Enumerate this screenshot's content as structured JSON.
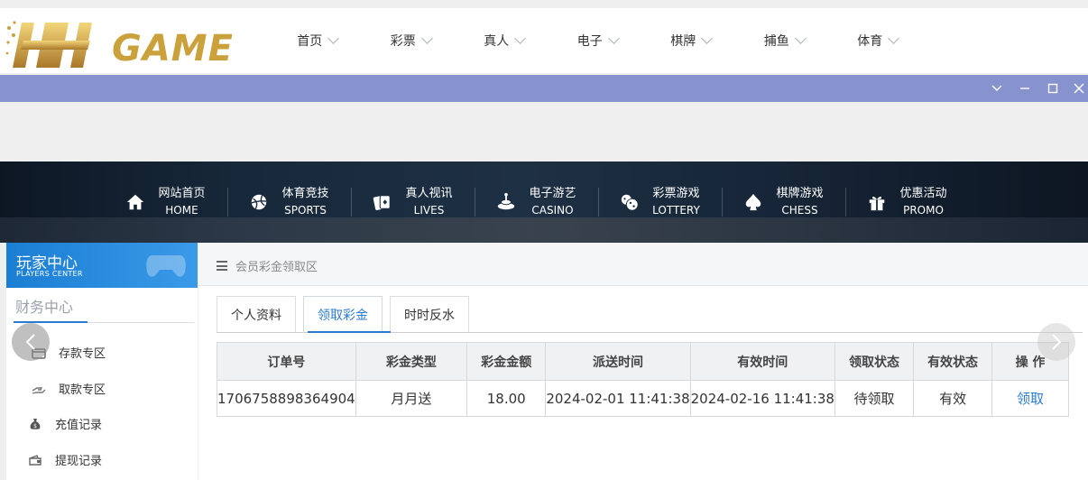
{
  "brand": {
    "logo_text": "GAME"
  },
  "top_menu": [
    {
      "label": "首页"
    },
    {
      "label": "彩票"
    },
    {
      "label": "真人"
    },
    {
      "label": "电子"
    },
    {
      "label": "棋牌"
    },
    {
      "label": "捕鱼"
    },
    {
      "label": "体育"
    }
  ],
  "banner_nav": [
    {
      "cn": "网站首页",
      "en": "HOME",
      "icon": "home-icon"
    },
    {
      "cn": "体育竞技",
      "en": "SPORTS",
      "icon": "ball-icon"
    },
    {
      "cn": "真人视讯",
      "en": "LIVES",
      "icon": "cards-icon"
    },
    {
      "cn": "电子游艺",
      "en": "CASINO",
      "icon": "slot-icon"
    },
    {
      "cn": "彩票游戏",
      "en": "LOTTERY",
      "icon": "dice-icon"
    },
    {
      "cn": "棋牌游戏",
      "en": "CHESS",
      "icon": "spade-icon"
    },
    {
      "cn": "优惠活动",
      "en": "PROMO",
      "icon": "gift-icon"
    }
  ],
  "sidebar": {
    "title_cn": "玩家中心",
    "title_en": "PLAYERS CENTER",
    "section": "财务中心",
    "links": [
      {
        "label": "存款专区",
        "icon": "deposit-icon"
      },
      {
        "label": "取款专区",
        "icon": "withdraw-icon"
      },
      {
        "label": "充值记录",
        "icon": "moneybag-icon"
      },
      {
        "label": "提现记录",
        "icon": "wallet-icon"
      }
    ]
  },
  "breadcrumb": "会员彩金领取区",
  "tabs": [
    {
      "label": "个人资料",
      "active": false
    },
    {
      "label": "领取彩金",
      "active": true
    },
    {
      "label": "时时反水",
      "active": false
    }
  ],
  "table": {
    "headers": [
      "订单号",
      "彩金类型",
      "彩金金额",
      "派送时间",
      "有效时间",
      "领取状态",
      "有效状态",
      "操 作"
    ],
    "rows": [
      [
        "1706758898364904",
        "月月送",
        "18.00",
        "2024-02-01 11:41:38",
        "2024-02-16 11:41:38",
        "待领取",
        "有效",
        "领取"
      ]
    ]
  },
  "colors": {
    "titlebar": "#8793ce",
    "accent": "#2b7bd0",
    "logo": "#caa13a"
  }
}
